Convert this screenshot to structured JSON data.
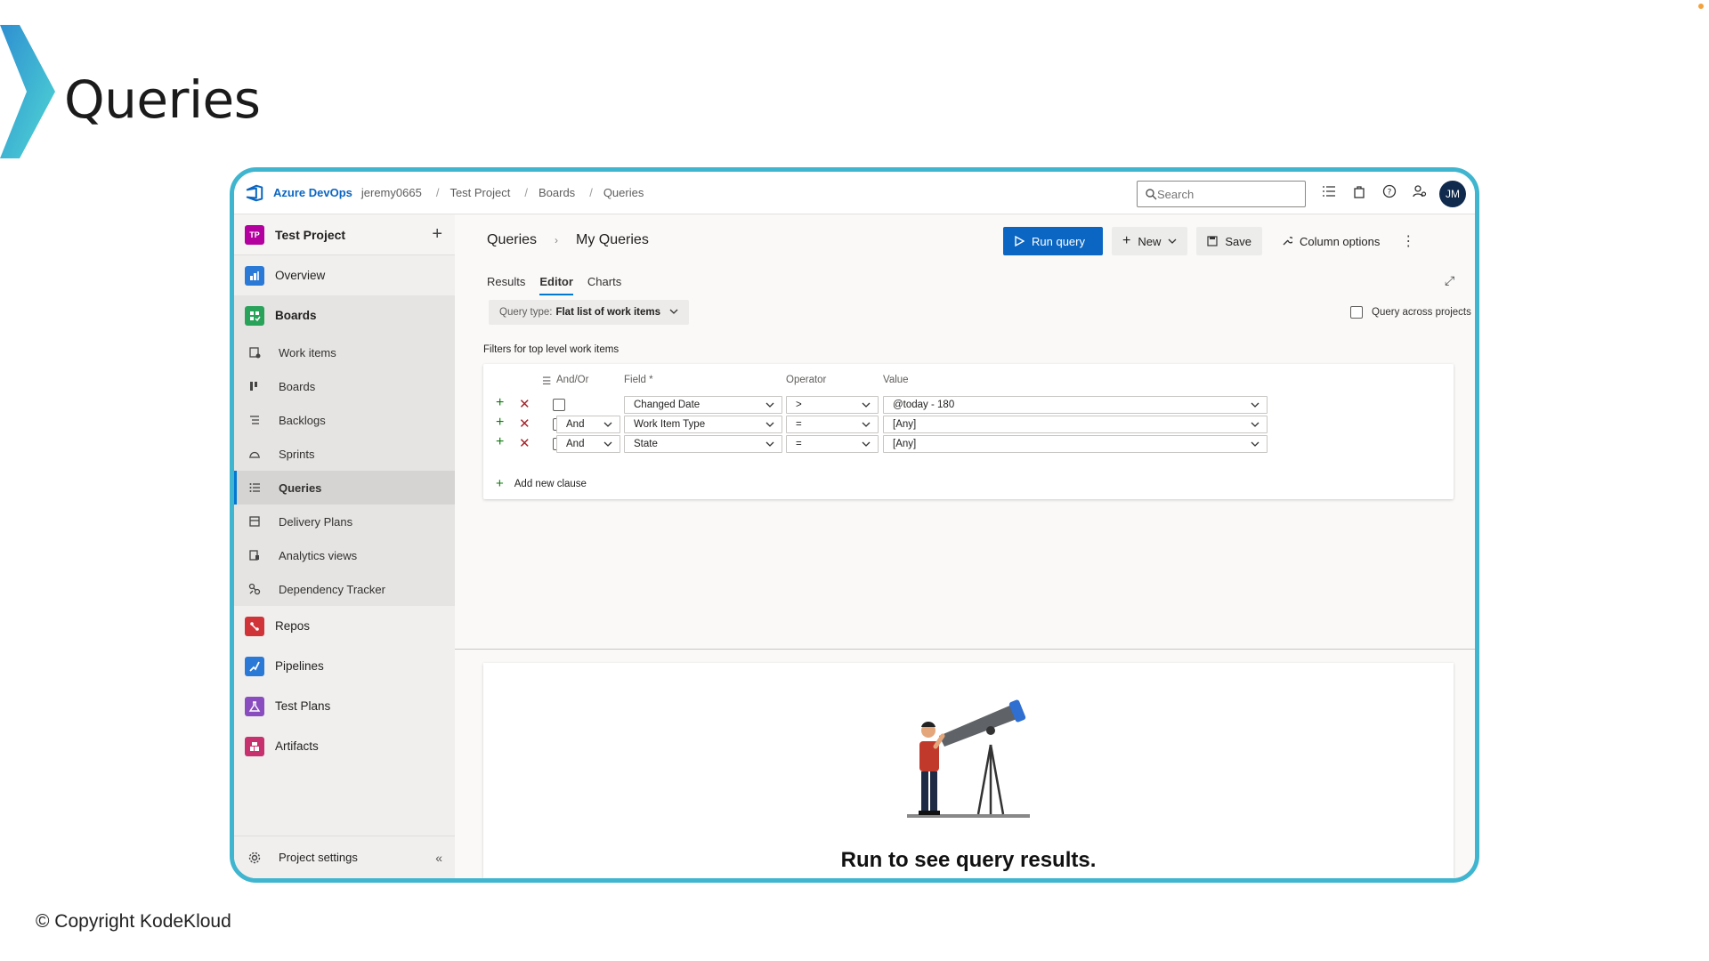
{
  "slide": {
    "title": "Queries",
    "copyright": "© Copyright KodeKloud"
  },
  "topbar": {
    "brand": "Azure DevOps",
    "org": "jeremy0665",
    "breadcrumb": [
      "Test Project",
      "Boards",
      "Queries"
    ],
    "search_placeholder": "Search",
    "avatar_initials": "JM"
  },
  "sidebar": {
    "project_badge": "TP",
    "project_name": "Test Project",
    "items": [
      {
        "label": "Overview",
        "icon": "overview-icon",
        "color": "#2b79d6"
      },
      {
        "label": "Boards",
        "icon": "boards-icon",
        "color": "#29a35a"
      },
      {
        "label": "Repos",
        "icon": "repos-icon",
        "color": "#d13438"
      },
      {
        "label": "Pipelines",
        "icon": "pipelines-icon",
        "color": "#2b79d6"
      },
      {
        "label": "Test Plans",
        "icon": "test-plans-icon",
        "color": "#8a4dbf"
      },
      {
        "label": "Artifacts",
        "icon": "artifacts-icon",
        "color": "#c6316e"
      }
    ],
    "boards_sub": [
      {
        "label": "Work items",
        "icon": "work-items-icon"
      },
      {
        "label": "Boards",
        "icon": "boards-sub-icon"
      },
      {
        "label": "Backlogs",
        "icon": "backlogs-icon"
      },
      {
        "label": "Sprints",
        "icon": "sprints-icon"
      },
      {
        "label": "Queries",
        "icon": "queries-icon"
      },
      {
        "label": "Delivery Plans",
        "icon": "delivery-plans-icon"
      },
      {
        "label": "Analytics views",
        "icon": "analytics-views-icon"
      },
      {
        "label": "Dependency Tracker",
        "icon": "dependency-tracker-icon"
      }
    ],
    "settings_label": "Project settings"
  },
  "main": {
    "crumb_root": "Queries",
    "crumb_current": "My Queries",
    "buttons": {
      "run_query": "Run query",
      "new": "New",
      "save": "Save",
      "column_options": "Column options"
    },
    "tabs": [
      "Results",
      "Editor",
      "Charts"
    ],
    "active_tab": "Editor",
    "query_type_label": "Query type:",
    "query_type_value": "Flat list of work items",
    "query_across": "Query across projects",
    "filters_label": "Filters for top level work items",
    "columns": {
      "and_or": "And/Or",
      "field": "Field *",
      "operator": "Operator",
      "value": "Value"
    },
    "clauses": [
      {
        "and_or": "",
        "field": "Changed Date",
        "operator": ">",
        "value": "@today - 180"
      },
      {
        "and_or": "And",
        "field": "Work Item Type",
        "operator": "=",
        "value": "[Any]"
      },
      {
        "and_or": "And",
        "field": "State",
        "operator": "=",
        "value": "[Any]"
      }
    ],
    "add_clause": "Add new clause",
    "empty_state": "Run to see query results."
  },
  "colors": {
    "frame": "#3fb5cf",
    "primary": "#0a66c2",
    "accent_teal": "#3ec7d6"
  }
}
